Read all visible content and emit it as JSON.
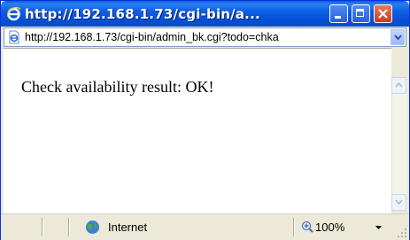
{
  "window": {
    "title": "http://192.168.1.73/cgi-bin/a..."
  },
  "address_bar": {
    "url": "http://192.168.1.73/cgi-bin/admin_bk.cgi?todo=chka"
  },
  "content": {
    "message": "Check availability result: OK!"
  },
  "status_bar": {
    "zone": "Internet",
    "zoom": "100%"
  },
  "colors": {
    "title_bar": "#0a5de6",
    "close_button": "#c93c1c",
    "window_frame": "#ece9d8"
  },
  "icons": [
    "ie-logo-icon",
    "minimize-icon",
    "maximize-icon",
    "close-icon",
    "page-icon",
    "chevron-down-icon",
    "scroll-up-icon",
    "scroll-down-icon",
    "globe-icon",
    "zoom-icon",
    "resize-grip-icon"
  ]
}
